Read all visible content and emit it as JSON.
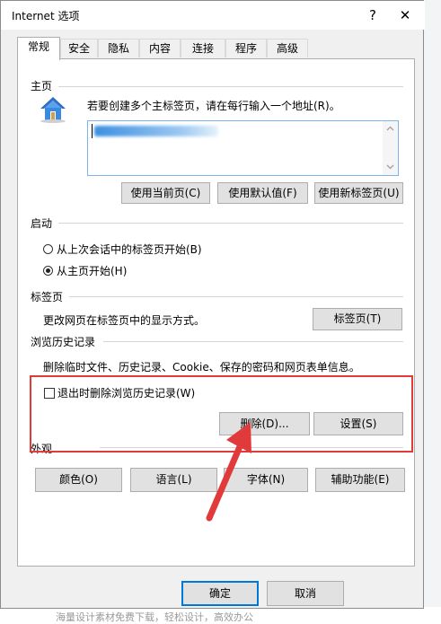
{
  "window": {
    "title": "Internet 选项",
    "help_glyph": "?",
    "close_glyph": "✕"
  },
  "tabs": [
    {
      "label": "常规",
      "active": true
    },
    {
      "label": "安全"
    },
    {
      "label": "隐私"
    },
    {
      "label": "内容"
    },
    {
      "label": "连接"
    },
    {
      "label": "程序"
    },
    {
      "label": "高级"
    }
  ],
  "homepage": {
    "group_label": "主页",
    "instruction": "若要创建多个主标签页，请在每行输入一个地址(R)。",
    "buttons": {
      "use_current": "使用当前页(C)",
      "use_default": "使用默认值(F)",
      "use_new_tab": "使用新标签页(U)"
    }
  },
  "startup": {
    "group_label": "启动",
    "options": [
      {
        "label": "从上次会话中的标签页开始(B)",
        "selected": false
      },
      {
        "label": "从主页开始(H)",
        "selected": true
      }
    ]
  },
  "tabs_section": {
    "group_label": "标签页",
    "description": "更改网页在标签页中的显示方式。",
    "button": "标签页(T)"
  },
  "history": {
    "group_label": "浏览历史记录",
    "description": "删除临时文件、历史记录、Cookie、保存的密码和网页表单信息。",
    "delete_on_exit": {
      "label": "退出时删除浏览历史记录(W)",
      "checked": false
    },
    "delete_button": "删除(D)...",
    "settings_button": "设置(S)"
  },
  "appearance": {
    "group_label": "外观",
    "buttons": {
      "colors": "颜色(O)",
      "languages": "语言(L)",
      "fonts": "字体(N)",
      "accessibility": "辅助功能(E)"
    }
  },
  "footer": {
    "ok": "确定",
    "cancel": "取消"
  },
  "background": {
    "bottom_text": "海量设计素材免费下载，轻松设计，高效办公"
  },
  "colors": {
    "annotation_red": "#e03a3a",
    "focus_blue": "#0078d7"
  }
}
